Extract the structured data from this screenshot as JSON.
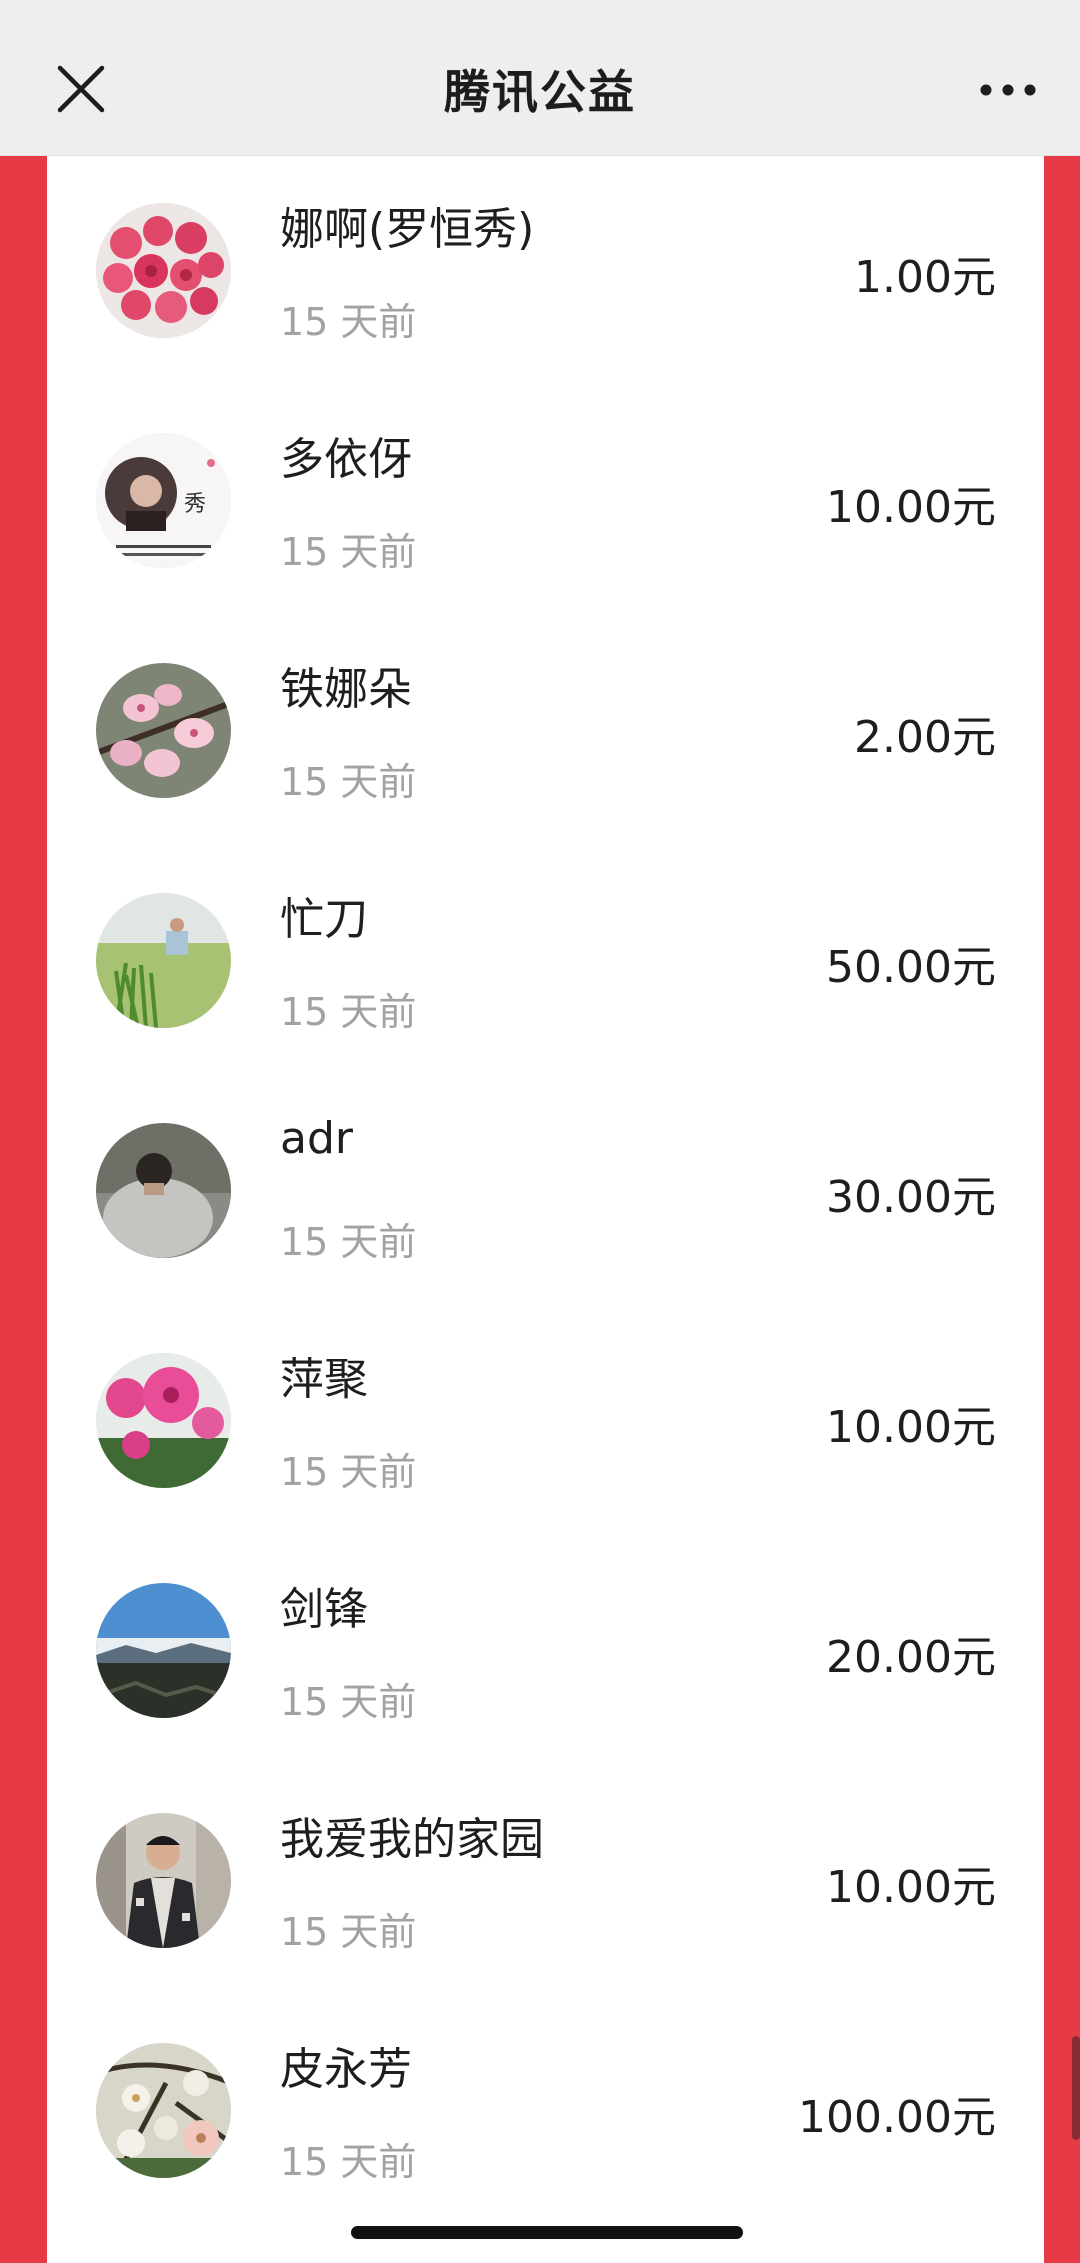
{
  "navbar": {
    "title": "腾讯公益",
    "close_icon": "close-icon",
    "more_icon": "more-dots-icon"
  },
  "colors": {
    "background_red": "#e63b46",
    "navbar_bg": "#efeeee",
    "text_primary": "#1e1e1e",
    "text_secondary": "#a2a2a2"
  },
  "donors": [
    {
      "name": "娜啊(罗恒秀)",
      "time": "15 天前",
      "amount": "1.00元",
      "avatar": "pink-roses-avatar"
    },
    {
      "name": "多依伢",
      "time": "15 天前",
      "amount": "10.00元",
      "avatar": "woman-portrait-avatar"
    },
    {
      "name": "铁娜朵",
      "time": "15 天前",
      "amount": "2.00元",
      "avatar": "peach-blossom-avatar"
    },
    {
      "name": "忙刀",
      "time": "15 天前",
      "amount": "50.00元",
      "avatar": "grass-field-avatar"
    },
    {
      "name": "adr",
      "time": "15 天前",
      "amount": "30.00元",
      "avatar": "person-back-avatar"
    },
    {
      "name": "萍聚",
      "time": "15 天前",
      "amount": "10.00元",
      "avatar": "pink-azalea-avatar"
    },
    {
      "name": "剑锋",
      "time": "15 天前",
      "amount": "20.00元",
      "avatar": "mountain-lake-avatar"
    },
    {
      "name": "我爱我的家园",
      "time": "15 天前",
      "amount": "10.00元",
      "avatar": "man-portrait-avatar"
    },
    {
      "name": "皮永芳",
      "time": "15 天前",
      "amount": "100.00元",
      "avatar": "white-flowers-avatar"
    }
  ]
}
